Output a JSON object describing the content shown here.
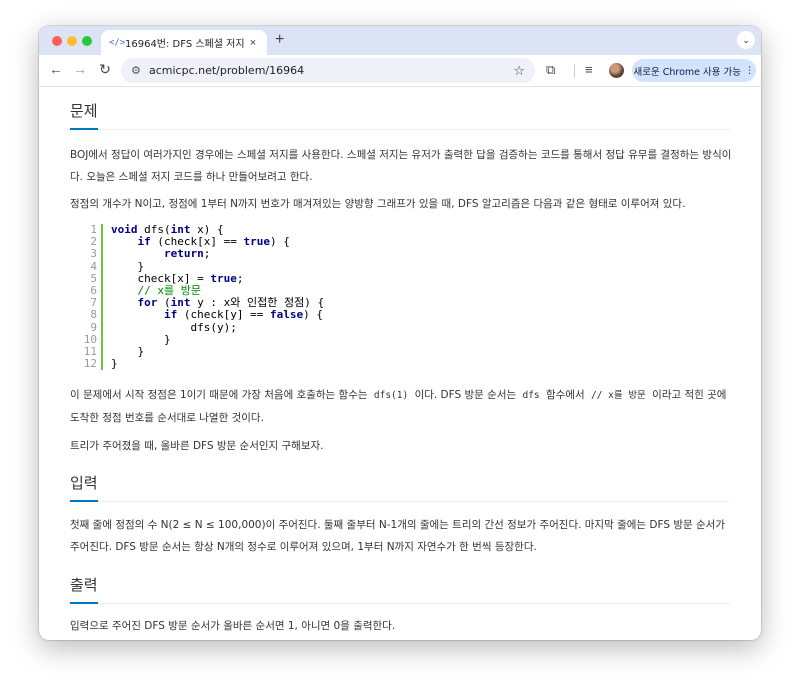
{
  "browser": {
    "tab": {
      "favicon": "</>",
      "title": "16964번: DFS 스페셜 저지",
      "close": "×"
    },
    "new_tab": "+",
    "tab_menu": "⌄",
    "url": "acmicpc.net/problem/16964",
    "chrome_button": "새로운 Chrome 사용 가능",
    "chrome_button_menu": "⋮",
    "icons": {
      "back": "arrow-left-icon",
      "forward": "arrow-right-icon",
      "reload": "reload-icon",
      "site_info": "tune-icon",
      "bookmark": "star-icon",
      "extensions": "puzzle-icon",
      "media": "media-queue-icon"
    }
  },
  "problem": {
    "heading": "문제",
    "p1": "BOJ에서 정답이 여러가지인 경우에는 스페셜 저지를 사용한다. 스페셜 저지는 유저가 출력한 답을 검증하는 코드를 통해서 정답 유무를 결정하는 방식이다. 오늘은 스페셜 저지 코드를 하나 만들어보려고 한다.",
    "p2": "정점의 개수가 N이고, 정점에 1부터 N까지 번호가 매겨져있는 양방향 그래프가 있을 때, DFS 알고리즘은 다음과 같은 형태로 이루어져 있다.",
    "code": [
      {
        "n": "1",
        "text": "void dfs(int x) {"
      },
      {
        "n": "2",
        "text": "    if (check[x] == true) {"
      },
      {
        "n": "3",
        "text": "        return;"
      },
      {
        "n": "4",
        "text": "    }"
      },
      {
        "n": "5",
        "text": "    check[x] = true;"
      },
      {
        "n": "6",
        "text": "    // x를 방문"
      },
      {
        "n": "7",
        "text": "    for (int y : x와 인접한 정점) {"
      },
      {
        "n": "8",
        "text": "        if (check[y] == false) {"
      },
      {
        "n": "9",
        "text": "            dfs(y);"
      },
      {
        "n": "10",
        "text": "        }"
      },
      {
        "n": "11",
        "text": "    }"
      },
      {
        "n": "12",
        "text": "}"
      }
    ],
    "p3_a": "이 문제에서 시작 정점은 1이기 때문에 가장 처음에 호출하는 함수는",
    "p3_code1": "dfs(1)",
    "p3_b": "이다. DFS 방문 순서는",
    "p3_code2": "dfs",
    "p3_c": "함수에서",
    "p3_code3": "// x를 방문",
    "p3_d": "이라고 적힌 곳에 도착한 정점 번호를 순서대로 나열한 것이다.",
    "p4": "트리가 주어졌을 때, 올바른 DFS 방문 순서인지 구해보자."
  },
  "input": {
    "heading": "입력",
    "p1": "첫째 줄에 정점의 수 N(2 ≤ N ≤ 100,000)이 주어진다. 둘째 줄부터 N-1개의 줄에는 트리의 간선 정보가 주어진다. 마지막 줄에는 DFS 방문 순서가 주어진다. DFS 방문 순서는 항상 N개의 정수로 이루어져 있으며, 1부터 N까지 자연수가 한 번씩 등장한다."
  },
  "output": {
    "heading": "출력",
    "p1": "입력으로 주어진 DFS 방문 순서가 올바른 순서면 1, 아니면 0을 출력한다."
  }
}
